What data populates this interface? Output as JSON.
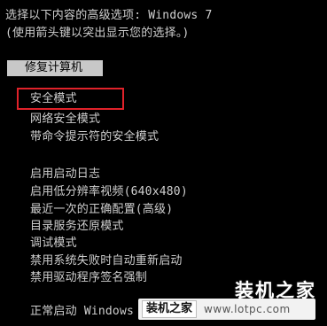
{
  "header": {
    "line1": "选择以下内容的高级选项: Windows 7",
    "line2": "(使用箭头键以突出显示您的选择。)"
  },
  "repair_item": "修复计算机",
  "menu": [
    "安全模式",
    "网络安全模式",
    "带命令提示符的安全模式",
    "启用启动日志",
    "启用低分辨率视频(640x480)",
    "最近一次的正确配置(高级)",
    "目录服务还原模式",
    "调试模式",
    "禁用系统失败时自动重新启动",
    "禁用驱动程序签名强制"
  ],
  "bottom": {
    "normal_start": "正常启动 Windows"
  },
  "watermark": {
    "logo": "装机之家",
    "brand": "装机之家",
    "url": "www.lotpc.com"
  },
  "colors": {
    "background": "#000000",
    "text": "#cfcfcf",
    "selected_bg": "#c8c8c8",
    "highlight_border": "#e0222a"
  }
}
